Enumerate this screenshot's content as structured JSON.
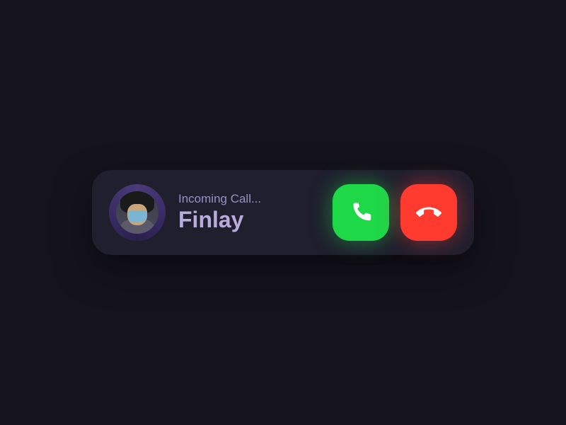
{
  "call": {
    "status": "Incoming Call...",
    "caller_name": "Finlay"
  },
  "colors": {
    "accept": "#1ed848",
    "decline": "#ff3b30",
    "card_bg": "#1f1f2e",
    "text_primary": "#b8acdc",
    "text_secondary": "#9b8fc7"
  }
}
